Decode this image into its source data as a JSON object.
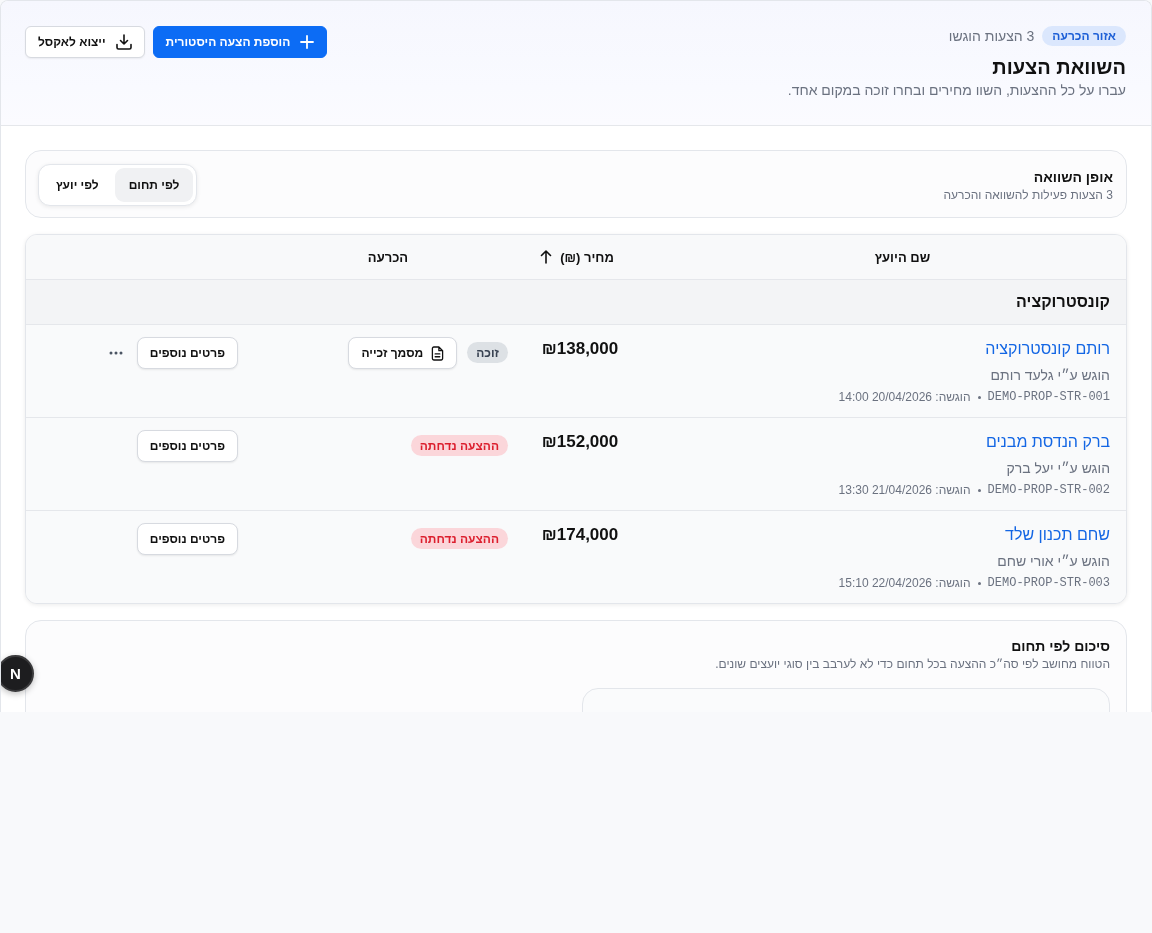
{
  "header": {
    "badge": "אזור הכרעה",
    "count": "3 הצעות הוגשו",
    "title": "השוואת הצעות",
    "subtitle": "עברו על כל ההצעות, השוו מחירים ובחרו זוכה במקום אחד.",
    "buttons": [
      {
        "label": "הוספת הצעה היסטורית",
        "kind": "primary"
      },
      {
        "label": "ייצוא לאקסל",
        "kind": "secondary"
      }
    ]
  },
  "comparison_mode": {
    "title": "אופן השוואה",
    "subtitle": "3 הצעות פעילות להשוואה והכרעה",
    "options": [
      {
        "label": "לפי תחום",
        "selected": true
      },
      {
        "label": "לפי יועץ",
        "selected": false
      }
    ]
  },
  "table": {
    "columns": [
      {
        "label": "שם היועץ",
        "sorted": false
      },
      {
        "label": "מחיר (₪)",
        "sorted": true
      },
      {
        "label": "הכרעה",
        "sorted": false
      }
    ],
    "groups": [
      {
        "name": "קונסטרוקציה",
        "rows": [
          {
            "name": "רותם קונסטרוקציה",
            "submitted_by": "הוגש ע״י גלעד רותם",
            "code": "DEMO-PROP-STR-001",
            "submitted_at": "הוגשה: 20/04/2026 14:00",
            "price": "₪138,000",
            "status": {
              "label": "זוכה",
              "kind": "won"
            },
            "document_button": "מסמך זכייה",
            "details_button": "פרטים נוספים",
            "menu": true
          },
          {
            "name": "ברק הנדסת מבנים",
            "submitted_by": "הוגש ע״י יעל ברק",
            "code": "DEMO-PROP-STR-002",
            "submitted_at": "הוגשה: 21/04/2026 13:30",
            "price": "₪152,000",
            "status": {
              "label": "ההצעה נדחתה",
              "kind": "rejected"
            },
            "details_button": "פרטים נוספים",
            "menu": false
          },
          {
            "name": "שחם תכנון שלד",
            "submitted_by": "הוגש ע״י אורי שחם",
            "code": "DEMO-PROP-STR-003",
            "submitted_at": "הוגשה: 22/04/2026 15:10",
            "price": "₪174,000",
            "status": {
              "label": "ההצעה נדחתה",
              "kind": "rejected"
            },
            "details_button": "פרטים נוספים",
            "menu": false
          }
        ]
      }
    ]
  },
  "summary": {
    "title": "סיכום לפי תחום",
    "subtitle": "הטווח מחושב לפי סה״כ ההצעה בכל תחום כדי לא לערבב בין סוגי יועצים שונים."
  },
  "dev_badge": {
    "label": "N"
  }
}
